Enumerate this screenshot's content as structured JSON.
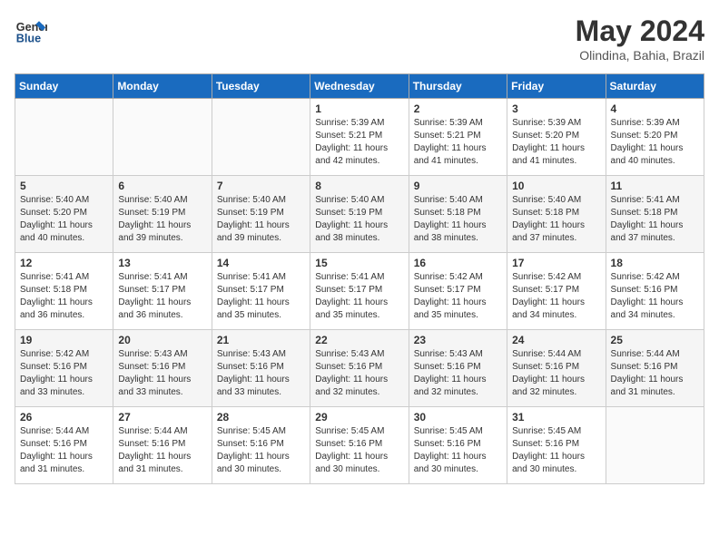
{
  "logo": {
    "line1": "General",
    "line2": "Blue"
  },
  "title": "May 2024",
  "location": "Olindina, Bahia, Brazil",
  "days_of_week": [
    "Sunday",
    "Monday",
    "Tuesday",
    "Wednesday",
    "Thursday",
    "Friday",
    "Saturday"
  ],
  "weeks": [
    [
      {
        "day": "",
        "info": ""
      },
      {
        "day": "",
        "info": ""
      },
      {
        "day": "",
        "info": ""
      },
      {
        "day": "1",
        "info": "Sunrise: 5:39 AM\nSunset: 5:21 PM\nDaylight: 11 hours\nand 42 minutes."
      },
      {
        "day": "2",
        "info": "Sunrise: 5:39 AM\nSunset: 5:21 PM\nDaylight: 11 hours\nand 41 minutes."
      },
      {
        "day": "3",
        "info": "Sunrise: 5:39 AM\nSunset: 5:20 PM\nDaylight: 11 hours\nand 41 minutes."
      },
      {
        "day": "4",
        "info": "Sunrise: 5:39 AM\nSunset: 5:20 PM\nDaylight: 11 hours\nand 40 minutes."
      }
    ],
    [
      {
        "day": "5",
        "info": "Sunrise: 5:40 AM\nSunset: 5:20 PM\nDaylight: 11 hours\nand 40 minutes."
      },
      {
        "day": "6",
        "info": "Sunrise: 5:40 AM\nSunset: 5:19 PM\nDaylight: 11 hours\nand 39 minutes."
      },
      {
        "day": "7",
        "info": "Sunrise: 5:40 AM\nSunset: 5:19 PM\nDaylight: 11 hours\nand 39 minutes."
      },
      {
        "day": "8",
        "info": "Sunrise: 5:40 AM\nSunset: 5:19 PM\nDaylight: 11 hours\nand 38 minutes."
      },
      {
        "day": "9",
        "info": "Sunrise: 5:40 AM\nSunset: 5:18 PM\nDaylight: 11 hours\nand 38 minutes."
      },
      {
        "day": "10",
        "info": "Sunrise: 5:40 AM\nSunset: 5:18 PM\nDaylight: 11 hours\nand 37 minutes."
      },
      {
        "day": "11",
        "info": "Sunrise: 5:41 AM\nSunset: 5:18 PM\nDaylight: 11 hours\nand 37 minutes."
      }
    ],
    [
      {
        "day": "12",
        "info": "Sunrise: 5:41 AM\nSunset: 5:18 PM\nDaylight: 11 hours\nand 36 minutes."
      },
      {
        "day": "13",
        "info": "Sunrise: 5:41 AM\nSunset: 5:17 PM\nDaylight: 11 hours\nand 36 minutes."
      },
      {
        "day": "14",
        "info": "Sunrise: 5:41 AM\nSunset: 5:17 PM\nDaylight: 11 hours\nand 35 minutes."
      },
      {
        "day": "15",
        "info": "Sunrise: 5:41 AM\nSunset: 5:17 PM\nDaylight: 11 hours\nand 35 minutes."
      },
      {
        "day": "16",
        "info": "Sunrise: 5:42 AM\nSunset: 5:17 PM\nDaylight: 11 hours\nand 35 minutes."
      },
      {
        "day": "17",
        "info": "Sunrise: 5:42 AM\nSunset: 5:17 PM\nDaylight: 11 hours\nand 34 minutes."
      },
      {
        "day": "18",
        "info": "Sunrise: 5:42 AM\nSunset: 5:16 PM\nDaylight: 11 hours\nand 34 minutes."
      }
    ],
    [
      {
        "day": "19",
        "info": "Sunrise: 5:42 AM\nSunset: 5:16 PM\nDaylight: 11 hours\nand 33 minutes."
      },
      {
        "day": "20",
        "info": "Sunrise: 5:43 AM\nSunset: 5:16 PM\nDaylight: 11 hours\nand 33 minutes."
      },
      {
        "day": "21",
        "info": "Sunrise: 5:43 AM\nSunset: 5:16 PM\nDaylight: 11 hours\nand 33 minutes."
      },
      {
        "day": "22",
        "info": "Sunrise: 5:43 AM\nSunset: 5:16 PM\nDaylight: 11 hours\nand 32 minutes."
      },
      {
        "day": "23",
        "info": "Sunrise: 5:43 AM\nSunset: 5:16 PM\nDaylight: 11 hours\nand 32 minutes."
      },
      {
        "day": "24",
        "info": "Sunrise: 5:44 AM\nSunset: 5:16 PM\nDaylight: 11 hours\nand 32 minutes."
      },
      {
        "day": "25",
        "info": "Sunrise: 5:44 AM\nSunset: 5:16 PM\nDaylight: 11 hours\nand 31 minutes."
      }
    ],
    [
      {
        "day": "26",
        "info": "Sunrise: 5:44 AM\nSunset: 5:16 PM\nDaylight: 11 hours\nand 31 minutes."
      },
      {
        "day": "27",
        "info": "Sunrise: 5:44 AM\nSunset: 5:16 PM\nDaylight: 11 hours\nand 31 minutes."
      },
      {
        "day": "28",
        "info": "Sunrise: 5:45 AM\nSunset: 5:16 PM\nDaylight: 11 hours\nand 30 minutes."
      },
      {
        "day": "29",
        "info": "Sunrise: 5:45 AM\nSunset: 5:16 PM\nDaylight: 11 hours\nand 30 minutes."
      },
      {
        "day": "30",
        "info": "Sunrise: 5:45 AM\nSunset: 5:16 PM\nDaylight: 11 hours\nand 30 minutes."
      },
      {
        "day": "31",
        "info": "Sunrise: 5:45 AM\nSunset: 5:16 PM\nDaylight: 11 hours\nand 30 minutes."
      },
      {
        "day": "",
        "info": ""
      }
    ]
  ]
}
